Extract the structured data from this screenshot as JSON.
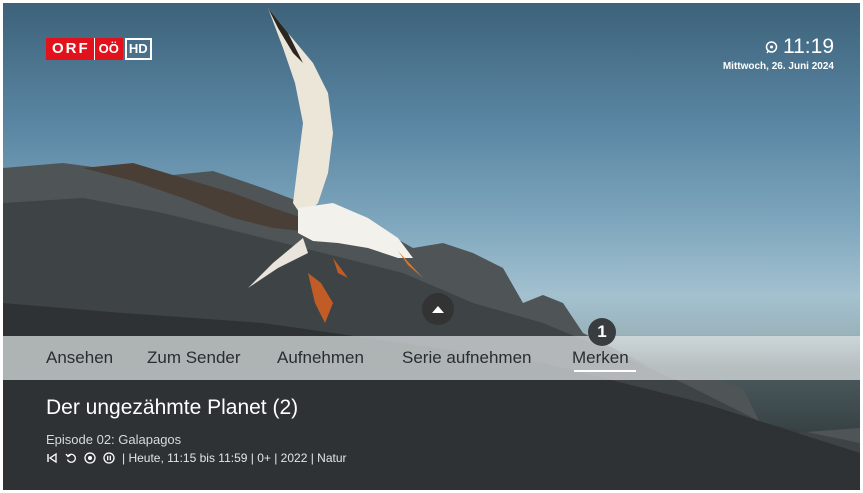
{
  "logo": {
    "brand": "ORF",
    "region": "OÖ",
    "quality": "HD"
  },
  "clock": {
    "time": "11:19",
    "date": "Mittwoch, 26. Juni 2024"
  },
  "menu": {
    "items": [
      "Ansehen",
      "Zum Sender",
      "Aufnehmen",
      "Serie aufnehmen",
      "Merken"
    ],
    "selected_index": 4,
    "badge": "1"
  },
  "program": {
    "title": "Der ungezähmte Planet (2)",
    "episode": "Episode 02: Galapagos",
    "meta": "| Heute, 11:15 bis 11:59 | 0+ | 2022 | Natur",
    "icons": [
      "skip-back-icon",
      "replay-icon",
      "record-icon",
      "pause-icon"
    ]
  },
  "colors": {
    "brand_red": "#e1121c",
    "menu_bg": "#e1e4e6"
  }
}
